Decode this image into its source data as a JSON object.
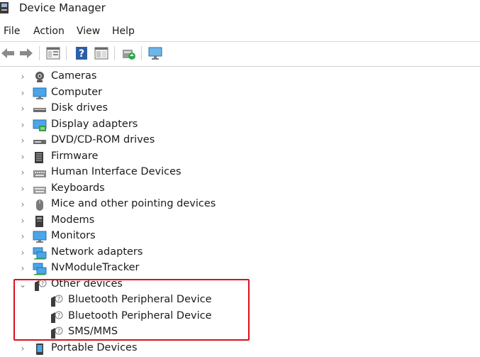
{
  "window": {
    "title": "Device Manager"
  },
  "menu": {
    "items": [
      "File",
      "Action",
      "View",
      "Help"
    ]
  },
  "toolbar": {
    "buttons": [
      "back-icon",
      "forward-icon",
      "properties-pane-icon",
      "help-icon",
      "view-icon",
      "scan-hardware-icon",
      "monitor-icon"
    ]
  },
  "tree": {
    "items": [
      {
        "label": "Cameras",
        "icon": "camera-icon",
        "expanded": false
      },
      {
        "label": "Computer",
        "icon": "computer-icon",
        "expanded": false
      },
      {
        "label": "Disk drives",
        "icon": "disk-drive-icon",
        "expanded": false
      },
      {
        "label": "Display adapters",
        "icon": "display-adapter-icon",
        "expanded": false
      },
      {
        "label": "DVD/CD-ROM drives",
        "icon": "dvd-drive-icon",
        "expanded": false
      },
      {
        "label": "Firmware",
        "icon": "firmware-icon",
        "expanded": false
      },
      {
        "label": "Human Interface Devices",
        "icon": "hid-icon",
        "expanded": false
      },
      {
        "label": "Keyboards",
        "icon": "keyboard-icon",
        "expanded": false
      },
      {
        "label": "Mice and other pointing devices",
        "icon": "mouse-icon",
        "expanded": false
      },
      {
        "label": "Modems",
        "icon": "modem-icon",
        "expanded": false
      },
      {
        "label": "Monitors",
        "icon": "monitor-icon",
        "expanded": false
      },
      {
        "label": "Network adapters",
        "icon": "network-adapter-icon",
        "expanded": false
      },
      {
        "label": "NvModuleTracker",
        "icon": "network-adapter-icon",
        "expanded": false
      },
      {
        "label": "Other devices",
        "icon": "unknown-device-icon",
        "expanded": true,
        "children": [
          {
            "label": "Bluetooth Peripheral Device",
            "icon": "unknown-device-icon"
          },
          {
            "label": "Bluetooth Peripheral Device",
            "icon": "unknown-device-icon"
          },
          {
            "label": "SMS/MMS",
            "icon": "unknown-device-icon"
          }
        ]
      },
      {
        "label": "Portable Devices",
        "icon": "portable-device-icon",
        "expanded": false
      }
    ]
  },
  "colors": {
    "highlight": "#d8101c",
    "accent": "#1e6fd0"
  }
}
